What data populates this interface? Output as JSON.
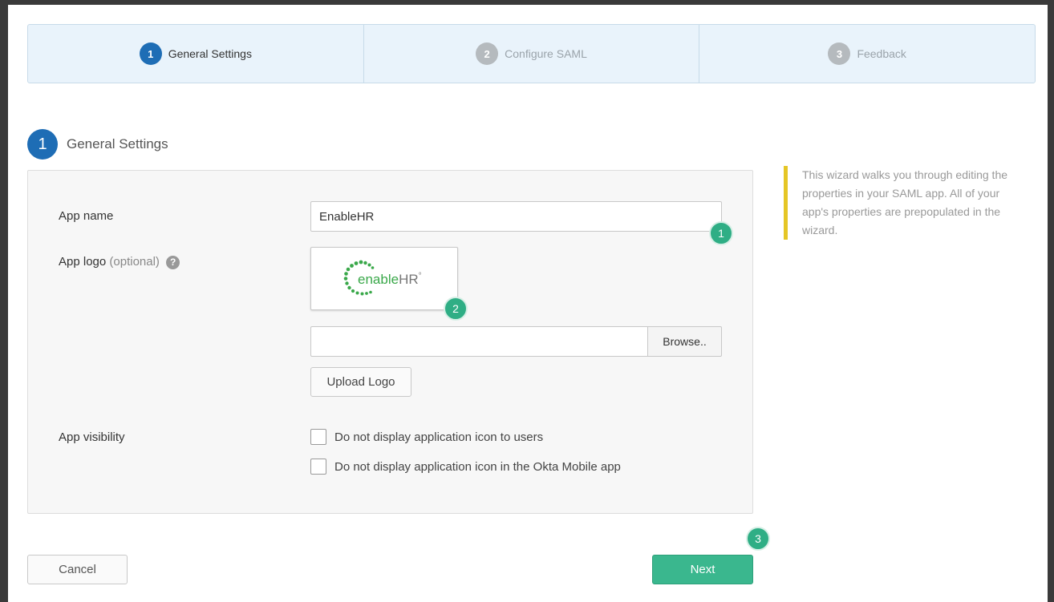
{
  "wizard": {
    "steps": [
      {
        "num": "1",
        "label": "General Settings"
      },
      {
        "num": "2",
        "label": "Configure SAML"
      },
      {
        "num": "3",
        "label": "Feedback"
      }
    ]
  },
  "section": {
    "num": "1",
    "title": "General Settings"
  },
  "form": {
    "app_name_label": "App name",
    "app_name_value": "EnableHR",
    "app_logo_label": "App logo",
    "app_logo_optional": "(optional)",
    "help_glyph": "?",
    "logo_text_a": "enable",
    "logo_text_b": "HR",
    "logo_mark": "°",
    "browse_label": "Browse..",
    "upload_label": "Upload Logo",
    "visibility_label": "App visibility",
    "check_users": "Do not display application icon to users",
    "check_mobile": "Do not display application icon in the Okta Mobile app"
  },
  "badges": {
    "one": "1",
    "two": "2",
    "three": "3"
  },
  "note": "This wizard walks you through editing the properties in your SAML app. All of your app's properties are prepopulated in the wizard.",
  "footer": {
    "cancel_label": "Cancel",
    "next_label": "Next"
  },
  "colors": {
    "primary": "#1e6db5",
    "success": "#3ab78e",
    "note_accent": "#e5c625"
  }
}
